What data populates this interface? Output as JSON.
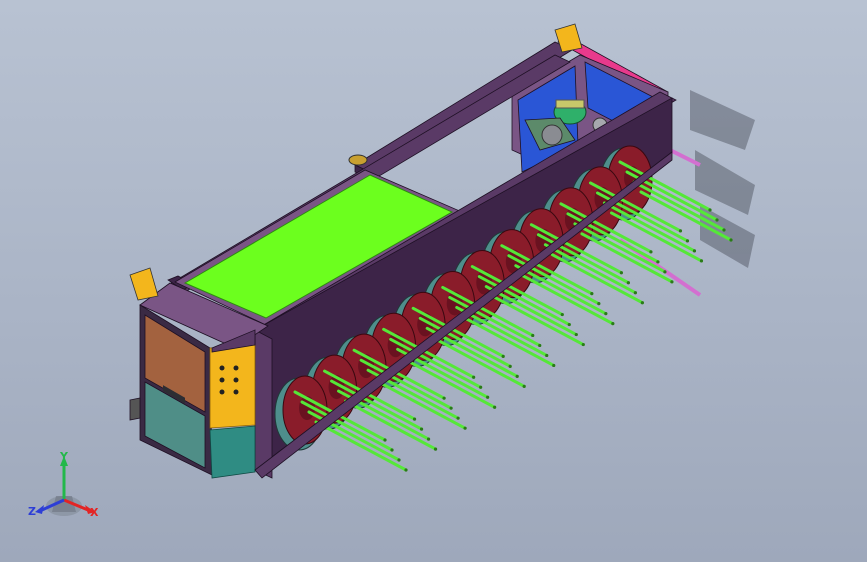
{
  "viewport": {
    "background_top": "#b8c2d2",
    "background_bottom": "#9ea8bb"
  },
  "model": {
    "colors": {
      "frame": "#5a3a66",
      "frame_dark": "#3d2448",
      "frame_light": "#7a5585",
      "top_panel": "#6cff1e",
      "rods": "#55e838",
      "discs": "#8a1c2a",
      "disc_rim": "#4e8e8c",
      "cabinet_brown": "#a3623f",
      "cabinet_teal": "#4f8e87",
      "panel_yellow": "#f3b61c",
      "panel_teal": "#2f8c83",
      "blue_plate": "#2a56d6",
      "pink_rail": "#e83a8c",
      "motor": "#2fb06a"
    },
    "disc_count": 12
  },
  "axis_triad": {
    "x_label": "X",
    "y_label": "Y",
    "z_label": "Z",
    "x_color": "#e32424",
    "y_color": "#22b84a",
    "z_color": "#2d3ed6"
  }
}
